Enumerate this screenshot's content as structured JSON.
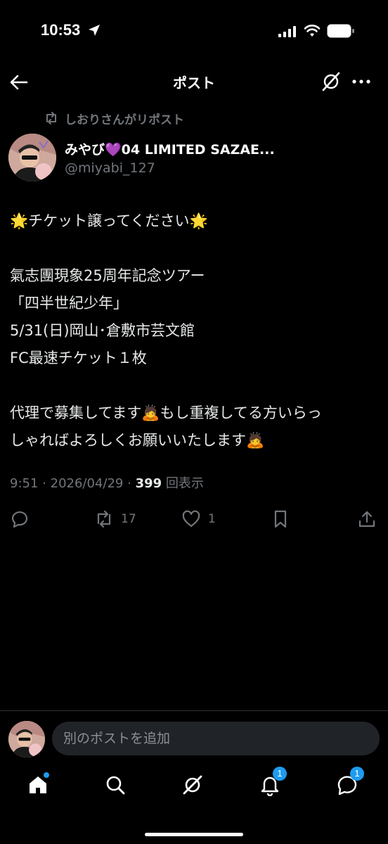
{
  "status_bar": {
    "time": "10:53"
  },
  "header": {
    "title": "ポスト"
  },
  "repost": {
    "text": "しおりさんがリポスト"
  },
  "author": {
    "name": "みやび💜04 LIMITED SAZAE...",
    "handle": "@miyabi_127"
  },
  "post": {
    "lines": [
      "🌟チケット譲ってください🌟",
      "",
      "氣志團現象25周年記念ツアー",
      "「四半世紀少年」",
      "5/31(日)岡山･倉敷市芸文館",
      "FC最速チケット１枚",
      "",
      "代理で募集してます🙇もし重複してる方いらっ",
      "しゃればよろしくお願いいたします🙇"
    ]
  },
  "meta": {
    "time": "9:51",
    "sep": "·",
    "date": "2026/04/29",
    "views": "399",
    "views_label": "回表示"
  },
  "actions": {
    "retweets": "17",
    "likes": "1"
  },
  "composer": {
    "placeholder": "別のポストを追加"
  },
  "nav": {
    "notifications_badge": "1",
    "messages_badge": "1"
  },
  "colors": {
    "background": "#000000",
    "text": "#e7e9ea",
    "muted": "#71767b",
    "accent": "#1d9bf0"
  }
}
